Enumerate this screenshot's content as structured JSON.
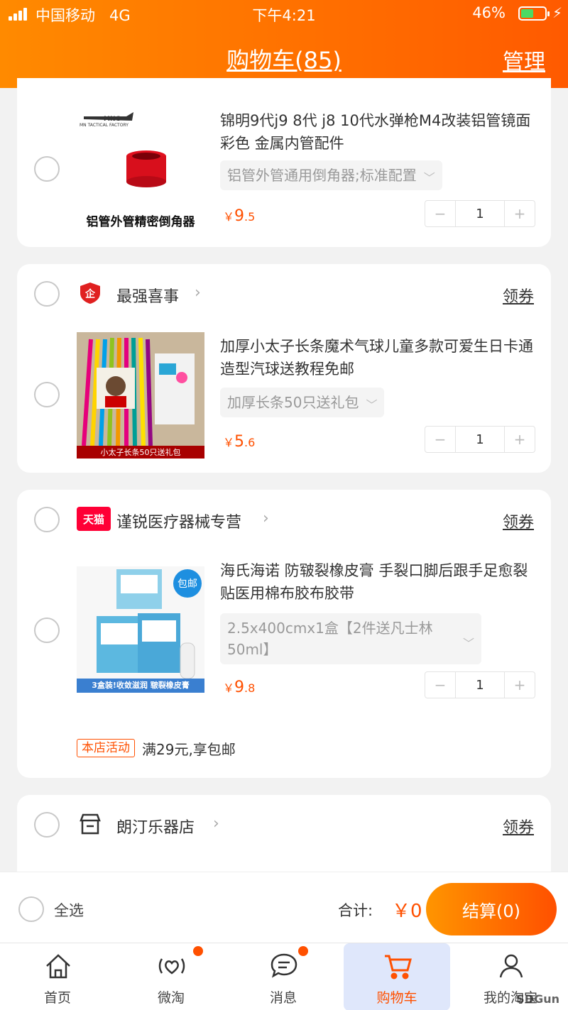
{
  "status_bar": {
    "carrier": "中国移动",
    "network": "4G",
    "time": "下午4:21",
    "battery": "46%"
  },
  "header": {
    "title": "购物车(85)",
    "manage": "管理"
  },
  "item1": {
    "brand": "MN TACTICAL FACTORY",
    "image_caption": "铝管外管精密倒角器",
    "title": "锦明9代j9 8代  j8 10代水弹枪M4改装铝管镜面彩色 金属内管配件",
    "sku": "铝管外管通用倒角器;标准配置",
    "currency": "￥",
    "price_int": "9",
    "price_dec": ".5",
    "qty": "1"
  },
  "shop2": {
    "name": "最强喜事",
    "coupon": "领券"
  },
  "item2": {
    "image_caption": "小太子长条50只送礼包",
    "title": "加厚小太子长条魔术气球儿童多款可爱生日卡通造型汽球送教程免邮",
    "sku": "加厚长条50只送礼包",
    "currency": "￥",
    "price_int": "5",
    "price_dec": ".6",
    "qty": "1"
  },
  "shop3": {
    "badge": "天猫",
    "name": "谨锐医疗器械专营",
    "coupon": "领券"
  },
  "item3": {
    "badge": "包邮",
    "image_caption": "3盒装!收敛滋润 皲裂橡皮膏",
    "title": "海氏海诺 防皲裂橡皮膏 手裂口脚后跟手足愈裂贴医用棉布胶布胶带",
    "sku": "2.5x400cmx1盒【2件送凡士林50ml】",
    "currency": "￥",
    "price_int": "9",
    "price_dec": ".8",
    "qty": "1",
    "promo_tag": "本店活动",
    "promo_text": "满29元,享包邮"
  },
  "shop4": {
    "name": "朗汀乐器店",
    "coupon": "领券"
  },
  "checkout": {
    "select_all": "全选",
    "total_label": "合计:",
    "total": "￥0",
    "button": "结算(0)"
  },
  "tabs": [
    {
      "label": "首页",
      "icon": "home-icon"
    },
    {
      "label": "微淘",
      "icon": "heart-signal-icon"
    },
    {
      "label": "消息",
      "icon": "chat-icon"
    },
    {
      "label": "购物车",
      "icon": "cart-icon"
    },
    {
      "label": "我的淘宝",
      "icon": "user-icon"
    }
  ],
  "watermark": "SDGun",
  "colors": {
    "accent": "#ff5000",
    "header_start": "#ff8a00",
    "header_end": "#ff5a00"
  }
}
